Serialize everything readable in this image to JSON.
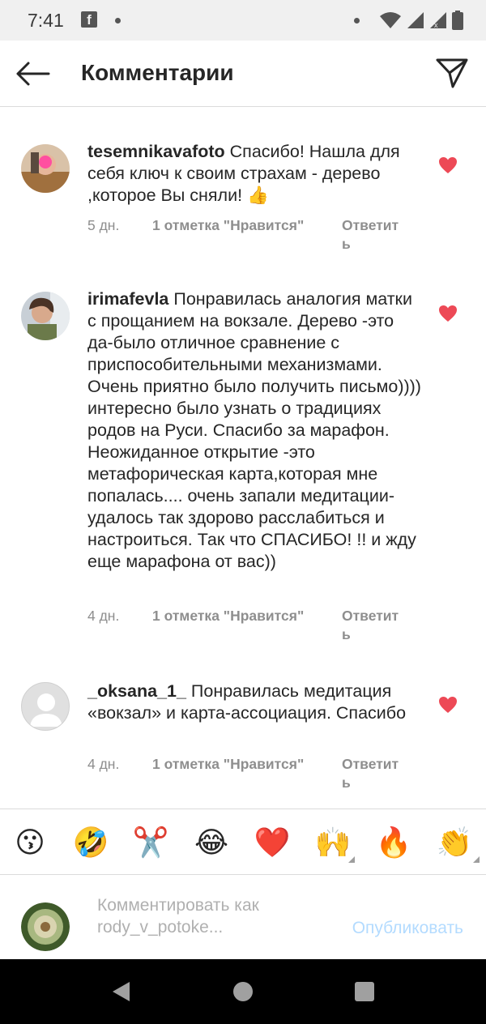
{
  "status_bar": {
    "time": "7:41",
    "app_icon": "facebook-icon"
  },
  "header": {
    "title": "Комментарии",
    "back_icon": "arrow-left-icon",
    "send_icon": "paper-plane-icon"
  },
  "comments": [
    {
      "username": "tesemnikavafoto",
      "text": "Спасибо! Нашла для себя ключ к своим страхам - дерево ,которое Вы сняли! 👍",
      "age": "5 дн.",
      "likes": "1 отметка \"Нравится\"",
      "reply": "Ответить",
      "liked": true
    },
    {
      "username": "irimafevla",
      "text": "Понравилась аналогия матки с прощанием на вокзале. Дерево -это да-было отличное сравнение с приспособительными механизмами. Очень приятно было получить письмо)))) интересно было узнать о традициях родов на Руси. Спасибо за марафон. Неожиданное открытие -это метафорическая карта,которая мне попалась.... очень запали медитации-удалось так здорово расслабиться и настроиться. Так что СПАСИБО! !! и жду еще марафона от вас))",
      "age": "4 дн.",
      "likes": "1 отметка \"Нравится\"",
      "reply": "Ответить",
      "liked": true
    },
    {
      "username": "_oksana_1_",
      "text": "Понравилась медитация «вокзал» и карта-ассоциация. Спасибо",
      "age": "4 дн.",
      "likes": "1 отметка \"Нравится\"",
      "reply": "Ответить",
      "liked": true
    }
  ],
  "emoji_bar": [
    "😗",
    "🤣",
    "✂️",
    "😂",
    "❤️",
    "🙌",
    "🔥",
    "👏"
  ],
  "compose": {
    "placeholder": "Комментировать как rody_v_potoke...",
    "publish_label": "Опубликовать"
  },
  "colors": {
    "like_red": "#ed4956",
    "publish_disabled": "#b3dbff",
    "meta_gray": "#8e8e8e"
  }
}
